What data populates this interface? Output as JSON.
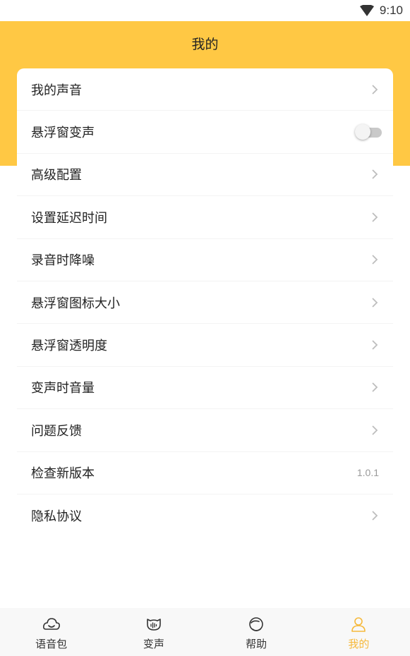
{
  "status_bar": {
    "time": "9:10"
  },
  "header": {
    "title": "我的"
  },
  "menu": [
    {
      "label": "我的声音",
      "type": "link"
    },
    {
      "label": "悬浮窗变声",
      "type": "toggle",
      "enabled": false
    },
    {
      "label": "高级配置",
      "type": "link"
    },
    {
      "label": "设置延迟时间",
      "type": "link"
    },
    {
      "label": "录音时降噪",
      "type": "link"
    },
    {
      "label": "悬浮窗图标大小",
      "type": "link"
    },
    {
      "label": "悬浮窗透明度",
      "type": "link"
    },
    {
      "label": "变声时音量",
      "type": "link"
    },
    {
      "label": "问题反馈",
      "type": "link"
    },
    {
      "label": "检查新版本",
      "type": "value",
      "value": "1.0.1"
    },
    {
      "label": "隐私协议",
      "type": "link"
    }
  ],
  "tabbar": {
    "tabs": [
      {
        "label": "语音包",
        "icon": "voice-pack-icon"
      },
      {
        "label": "变声",
        "icon": "voice-change-icon"
      },
      {
        "label": "帮助",
        "icon": "help-icon"
      },
      {
        "label": "我的",
        "icon": "profile-icon",
        "active": true
      }
    ]
  },
  "colors": {
    "accent": "#ffc844",
    "active_tab": "#f6b93b",
    "chevron": "#bdbdbd"
  }
}
